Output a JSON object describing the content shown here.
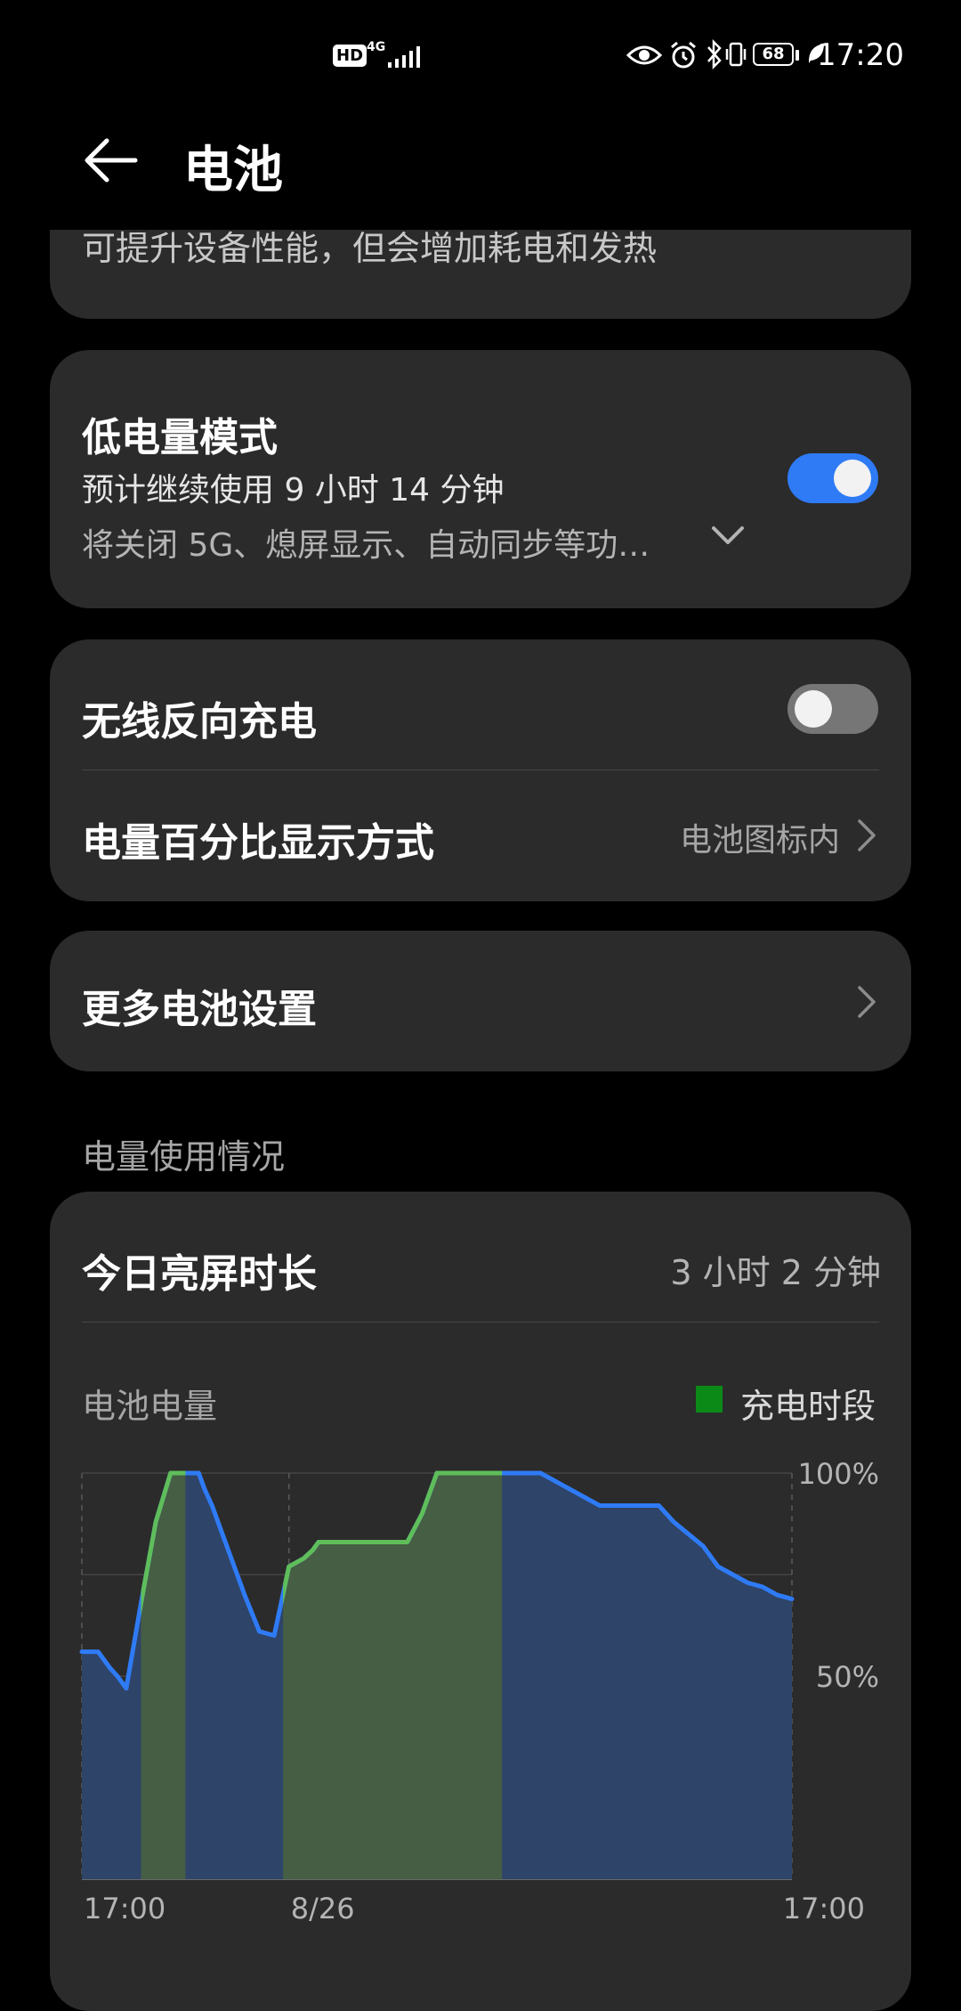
{
  "status_bar": {
    "hd_badge": "HD",
    "network_type": "4G",
    "battery_level": "68",
    "time": "17:20",
    "icons": [
      "hd-icon",
      "signal-icon",
      "eye-comfort-icon",
      "alarm-icon",
      "bluetooth-icon",
      "vibrate-icon",
      "battery-icon",
      "power-saving-leaf-icon"
    ]
  },
  "header": {
    "title": "电池",
    "back_icon": "back-arrow-icon"
  },
  "performance_card": {
    "description": "可提升设备性能，但会增加耗电和发热"
  },
  "low_power_mode": {
    "title": "低电量模式",
    "estimate": "预计继续使用 9 小时 14 分钟",
    "description": "将关闭 5G、熄屏显示、自动同步等功…",
    "enabled": true
  },
  "wireless_reverse_charging": {
    "title": "无线反向充电",
    "enabled": false
  },
  "percentage_display": {
    "title": "电量百分比显示方式",
    "value": "电池图标内"
  },
  "more_settings": {
    "title": "更多电池设置"
  },
  "usage_section": {
    "label": "电量使用情况",
    "screen_time_title": "今日亮屏时长",
    "screen_time_value": "3 小时 2 分钟"
  },
  "chart_data": {
    "type": "area",
    "title": "电池电量",
    "legend": [
      {
        "name": "充电时段",
        "color": "#0c8a18"
      }
    ],
    "x_tick_labels": [
      "17:00",
      "8/26",
      "17:00"
    ],
    "y_tick_labels": [
      "100%",
      "50%"
    ],
    "ylim": [
      0,
      100
    ],
    "xlim": [
      0,
      24
    ],
    "colors": {
      "line": "#2f7bf6",
      "charging_line": "#5fbe5a",
      "area": "#2e4468",
      "charging_area": "#455e44"
    },
    "series": [
      {
        "name": "充电时段",
        "x": [
          0,
          0.55,
          0.75,
          0.95,
          1.2,
          1.5,
          2.0,
          2.5,
          3.0,
          3.5,
          3.95,
          4.15,
          4.4,
          4.7,
          5.0,
          5.5,
          6.0,
          6.5,
          7.0,
          7.5,
          7.8,
          8.0,
          8.25,
          9.0,
          9.5,
          10.0,
          10.5,
          11.0,
          11.5,
          12.0,
          12.5,
          13.0,
          13.5,
          14.0,
          14.5,
          15.0,
          15.5,
          16.0,
          16.5,
          17.0,
          17.5,
          18.0,
          18.5,
          19.0,
          19.5,
          20.0,
          20.5,
          21.0,
          21.5,
          22.0,
          22.5,
          23.0,
          23.5,
          24.0
        ],
        "y": [
          56,
          56,
          54,
          52,
          50,
          47,
          68,
          88,
          100,
          100,
          100,
          96,
          92,
          86,
          80,
          70,
          61,
          60,
          77,
          79,
          81,
          83,
          83,
          83,
          83,
          83,
          83,
          83,
          90,
          100,
          100,
          100,
          100,
          100,
          100,
          100,
          100,
          98,
          96,
          94,
          92,
          92,
          92,
          92,
          92,
          88,
          85,
          82,
          77,
          75,
          73,
          72,
          70,
          69
        ],
        "charging_intervals": [
          [
            2.0,
            3.5
          ],
          [
            6.8,
            14.2
          ]
        ]
      }
    ],
    "grid": true
  }
}
